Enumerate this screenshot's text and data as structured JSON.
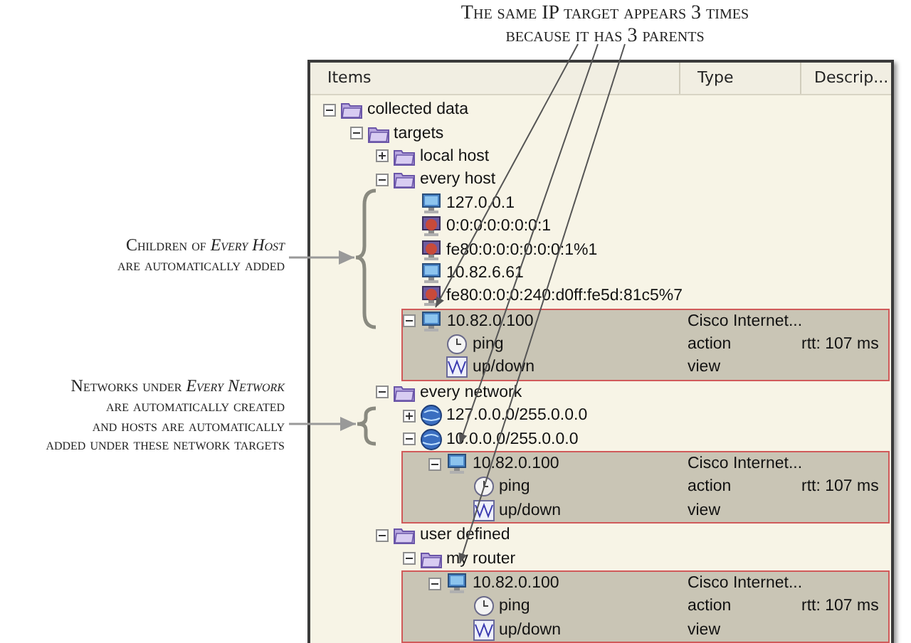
{
  "annotations": {
    "top": {
      "lines": [
        "The same IP target appears 3 times",
        "because it has 3 parents"
      ]
    },
    "left": [
      {
        "lines": [
          "Children of *Every Host*",
          "are automatically added"
        ]
      },
      {
        "lines": [
          "Networks under *Every Network*",
          "are automatically created",
          "and hosts are automatically",
          "added under these network targets"
        ]
      }
    ]
  },
  "columns": [
    "Items",
    "Type",
    "Descrip..."
  ],
  "tree": [
    {
      "label": "collected data",
      "kind": "folder",
      "expanded": true,
      "highlighted": false,
      "children": [
        {
          "label": "targets",
          "kind": "folder",
          "expanded": true,
          "highlighted": false,
          "children": [
            {
              "label": "local host",
              "kind": "folder",
              "expanded": false,
              "highlighted": false
            },
            {
              "label": "every host",
              "kind": "folder",
              "expanded": true,
              "highlighted": false,
              "children": [
                {
                  "label": "127.0.0.1",
                  "kind": "computer",
                  "highlighted": false
                },
                {
                  "label": "0:0:0:0:0:0:0:1",
                  "kind": "alert-computer",
                  "highlighted": false
                },
                {
                  "label": "fe80:0:0:0:0:0:0:1%1",
                  "kind": "alert-computer",
                  "highlighted": false
                },
                {
                  "label": "10.82.6.61",
                  "kind": "computer",
                  "highlighted": false
                },
                {
                  "label": "fe80:0:0:0:240:d0ff:fe5d:81c5%7",
                  "kind": "alert-computer",
                  "highlighted": false
                },
                {
                  "label": "10.82.0.100",
                  "kind": "computer",
                  "expanded": true,
                  "highlighted": true,
                  "type": "Cisco Internet...",
                  "children": [
                    {
                      "label": "ping",
                      "kind": "clock",
                      "highlighted": false,
                      "type": "action",
                      "description": "rtt: 107 ms"
                    },
                    {
                      "label": "up/down",
                      "kind": "graph",
                      "highlighted": false,
                      "type": "view"
                    }
                  ]
                }
              ]
            },
            {
              "label": "every network",
              "kind": "folder",
              "expanded": true,
              "highlighted": false,
              "children": [
                {
                  "label": "127.0.0.0/255.0.0.0",
                  "kind": "network",
                  "expanded": false,
                  "highlighted": false
                },
                {
                  "label": "10.0.0.0/255.0.0.0",
                  "kind": "network",
                  "expanded": true,
                  "highlighted": false,
                  "children": [
                    {
                      "label": "10.82.0.100",
                      "kind": "computer",
                      "expanded": true,
                      "highlighted": true,
                      "type": "Cisco Internet...",
                      "children": [
                        {
                          "label": "ping",
                          "kind": "clock",
                          "highlighted": false,
                          "type": "action",
                          "description": "rtt: 107 ms"
                        },
                        {
                          "label": "up/down",
                          "kind": "graph",
                          "highlighted": false,
                          "type": "view"
                        }
                      ]
                    }
                  ]
                }
              ]
            },
            {
              "label": "user defined",
              "kind": "folder",
              "expanded": true,
              "highlighted": false,
              "children": [
                {
                  "label": "my router",
                  "kind": "folder",
                  "expanded": true,
                  "highlighted": false,
                  "children": [
                    {
                      "label": "10.82.0.100",
                      "kind": "computer",
                      "expanded": true,
                      "highlighted": true,
                      "type": "Cisco Internet...",
                      "children": [
                        {
                          "label": "ping",
                          "kind": "clock",
                          "highlighted": false,
                          "type": "action",
                          "description": "rtt: 107 ms"
                        },
                        {
                          "label": "up/down",
                          "kind": "graph",
                          "highlighted": false,
                          "type": "view"
                        }
                      ]
                    }
                  ]
                }
              ]
            }
          ]
        }
      ]
    }
  ]
}
